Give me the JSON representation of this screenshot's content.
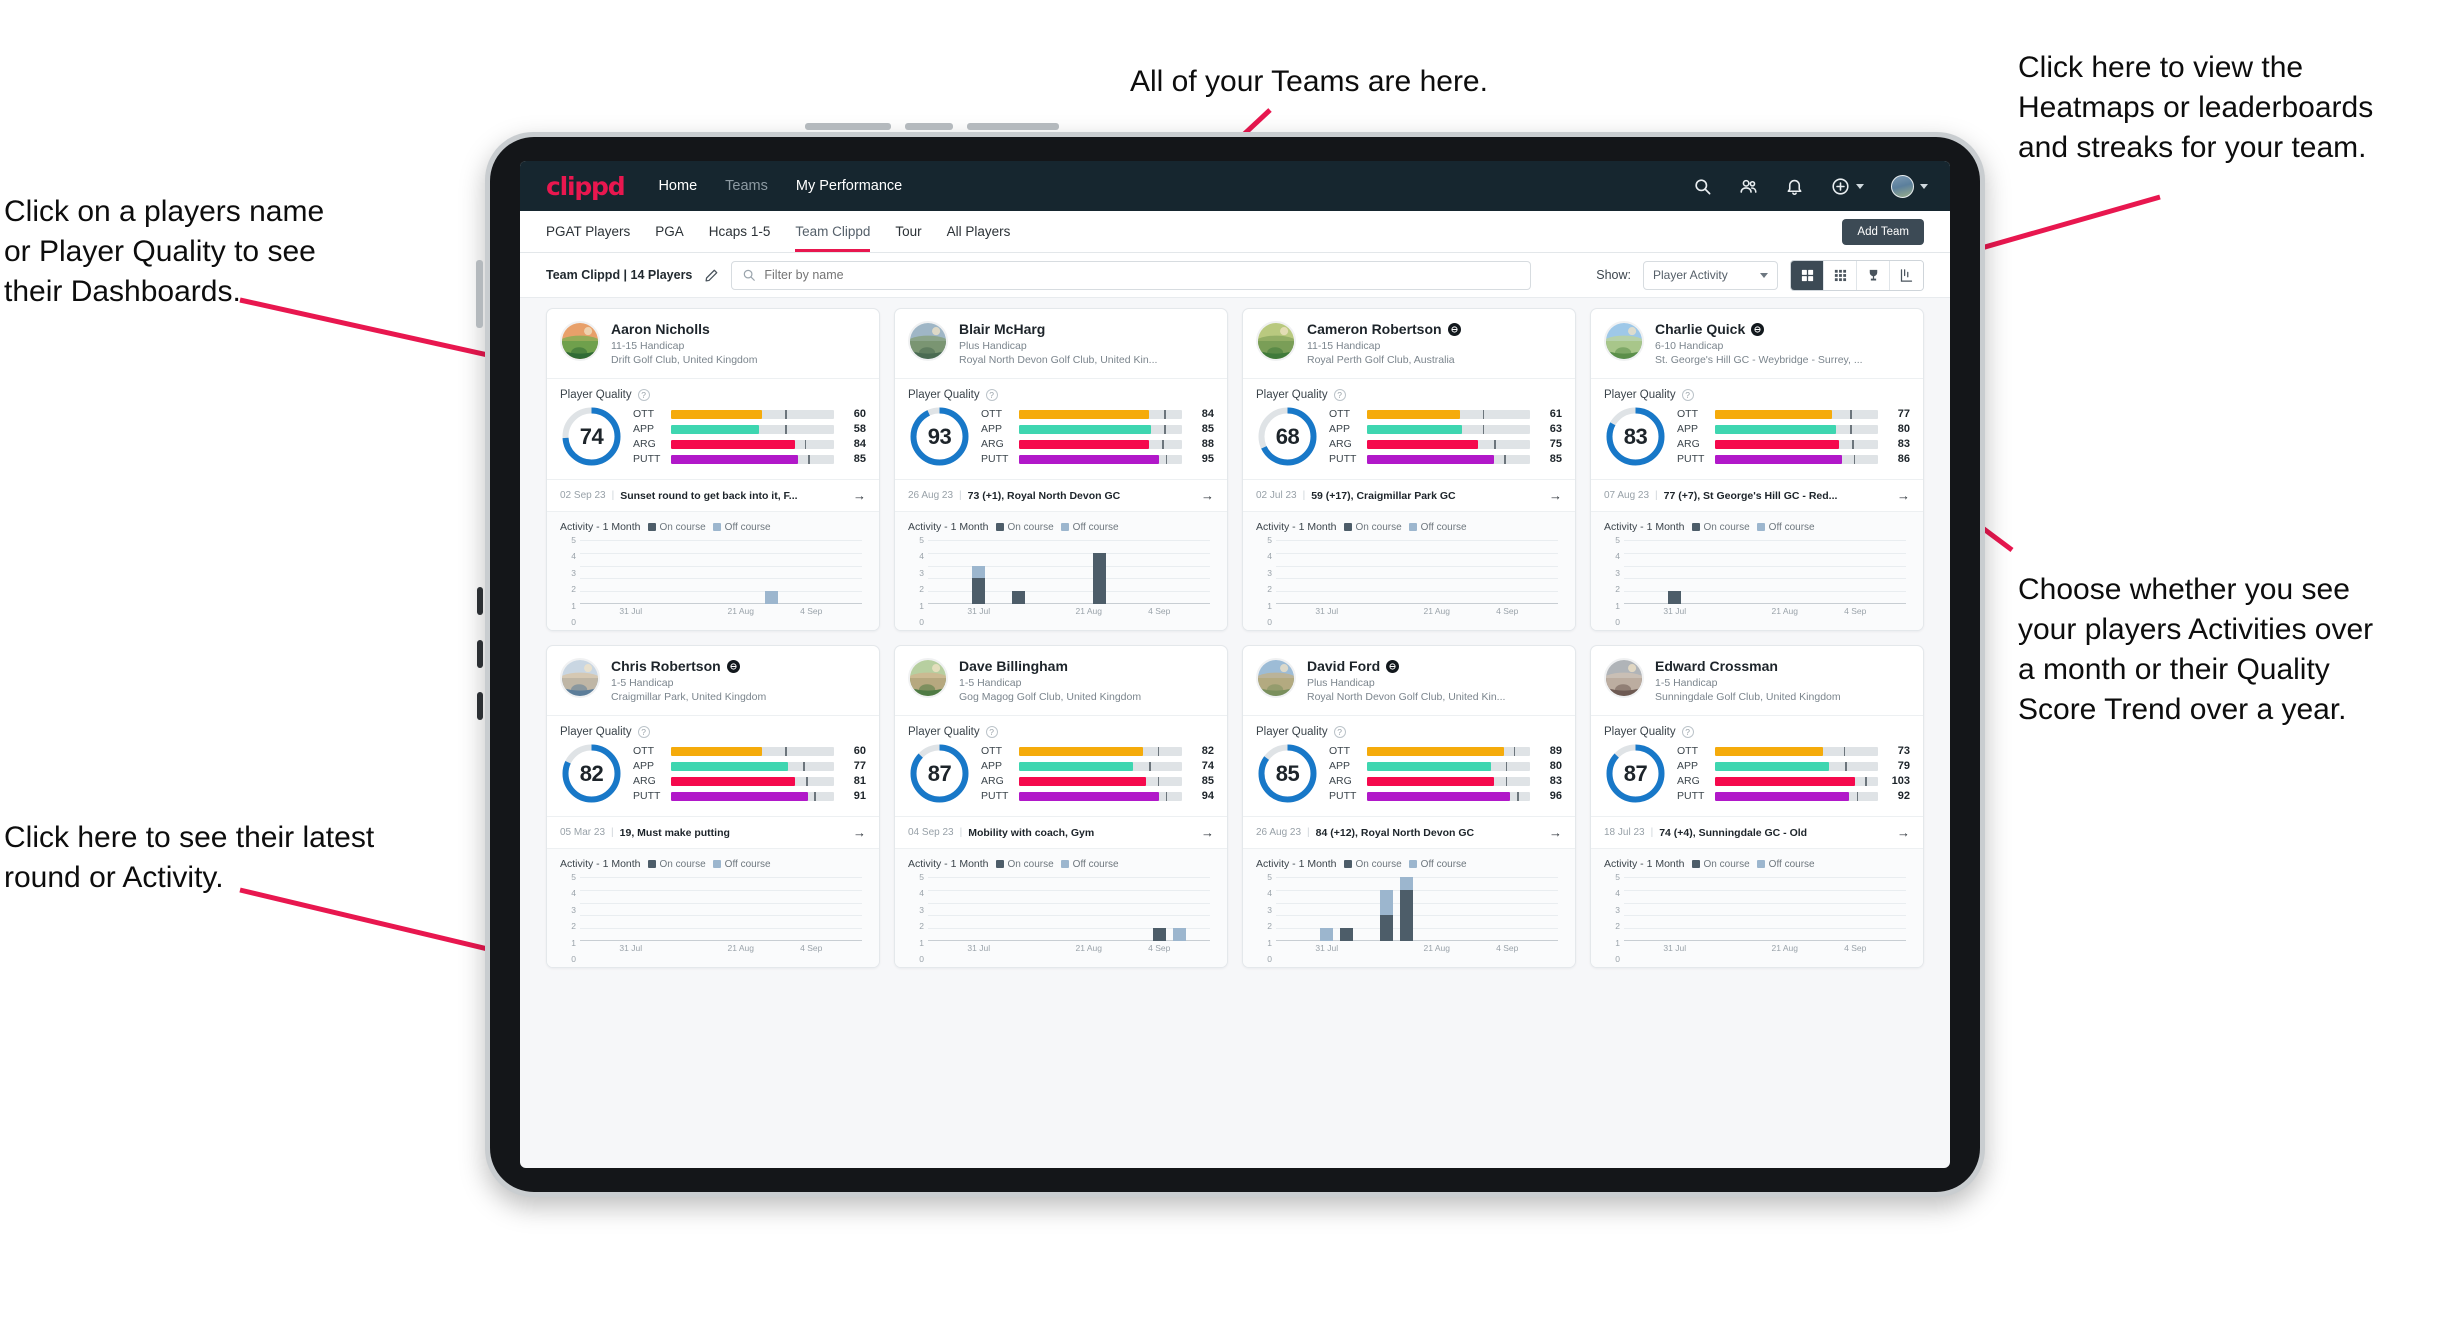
{
  "annotations": [
    {
      "id": "teams",
      "text": "All of your Teams are here."
    },
    {
      "id": "heatmaps",
      "text": "Click here to view the\nHeatmaps or leaderboards\nand streaks for your team."
    },
    {
      "id": "players-name",
      "text": "Click on a players name\nor Player Quality to see\ntheir Dashboards."
    },
    {
      "id": "show-toggle",
      "text": "Choose whether you see\nyour players Activities over\na month or their Quality\nScore Trend over a year."
    },
    {
      "id": "latest-round",
      "text": "Click here to see their latest\nround or Activity."
    }
  ],
  "navbar": {
    "brand": "clippd",
    "links": [
      {
        "label": "Home",
        "active": true
      },
      {
        "label": "Teams",
        "active": false
      },
      {
        "label": "My Performance",
        "active": true
      }
    ],
    "icons": [
      "search-icon",
      "people-icon",
      "bell-icon",
      "plus-circle-icon",
      "avatar"
    ]
  },
  "tabbar": {
    "tabs": [
      {
        "label": "PGAT Players",
        "active": false
      },
      {
        "label": "PGA",
        "active": false
      },
      {
        "label": "Hcaps 1-5",
        "active": false
      },
      {
        "label": "Team Clippd",
        "active": true
      },
      {
        "label": "Tour",
        "active": false
      },
      {
        "label": "All Players",
        "active": false
      }
    ],
    "add_team_label": "Add Team"
  },
  "filterbar": {
    "team_label": "Team Clippd | 14 Players",
    "edit_icon": "pencil-icon",
    "search_placeholder": "Filter by name",
    "search_value": "",
    "show_label": "Show:",
    "show_value": "Player Activity",
    "show_options": [
      "Player Activity",
      "Quality Score Trend"
    ],
    "view_buttons": [
      {
        "name": "grid-large-view",
        "active": true
      },
      {
        "name": "grid-small-view",
        "active": false
      },
      {
        "name": "leaderboard-trophy-view",
        "active": false
      },
      {
        "name": "heatmap-view",
        "active": false
      }
    ]
  },
  "card_labels": {
    "player_quality": "Player Quality",
    "activity": "Activity - 1 Month",
    "legend_on": "On course",
    "legend_off": "Off course",
    "metric_names": [
      "OTT",
      "APP",
      "ARG",
      "PUTT"
    ],
    "x_ticks": [
      "31 Jul",
      "21 Aug",
      "4 Sep"
    ],
    "y_ticks": [
      "5",
      "4",
      "3",
      "2",
      "1",
      "0"
    ],
    "arrow": "→",
    "help": "?"
  },
  "colors": {
    "brand": "#e8174f",
    "navbar": "#16262f",
    "ring": "#1878c8",
    "ott": "#f5ab0b",
    "app": "#3ed6b0",
    "arg": "#f5094d",
    "putt": "#b118c9",
    "on_course": "#4d5d69",
    "off_course": "#9cb6ce"
  },
  "players": [
    {
      "name": "Aaron Nicholls",
      "verified": false,
      "handicap": "11-15 Handicap",
      "club": "Drift Golf Club, United Kingdom",
      "quality": 74,
      "metrics": [
        {
          "label": "OTT",
          "value": 60,
          "fill": 56,
          "tick": 70
        },
        {
          "label": "APP",
          "value": 58,
          "fill": 54,
          "tick": 70
        },
        {
          "label": "ARG",
          "value": 84,
          "fill": 76,
          "tick": 82
        },
        {
          "label": "PUTT",
          "value": 85,
          "fill": 78,
          "tick": 84
        }
      ],
      "round": {
        "date": "02 Sep 23",
        "text": "Sunset round to get back into it, F..."
      },
      "chart_data": {
        "type": "bar",
        "stacked": true,
        "categories": [
          "c1",
          "c2",
          "c3",
          "c4",
          "c5",
          "c6",
          "c7",
          "c8",
          "c9",
          "c10",
          "c11",
          "c12",
          "c13",
          "c14"
        ],
        "series": [
          {
            "name": "On course",
            "values": [
              0,
              0,
              0,
              0,
              0,
              0,
              0,
              0,
              0,
              0,
              0,
              0,
              0,
              0
            ]
          },
          {
            "name": "Off course",
            "values": [
              0,
              0,
              0,
              0,
              0,
              0,
              0,
              0,
              0,
              1,
              0,
              0,
              0,
              0
            ]
          }
        ],
        "ylim": [
          0,
          5
        ]
      }
    },
    {
      "name": "Blair McHarg",
      "verified": false,
      "handicap": "Plus Handicap",
      "club": "Royal North Devon Golf Club, United Kin...",
      "quality": 93,
      "metrics": [
        {
          "label": "OTT",
          "value": 84,
          "fill": 80,
          "tick": 89
        },
        {
          "label": "APP",
          "value": 85,
          "fill": 81,
          "tick": 89
        },
        {
          "label": "ARG",
          "value": 88,
          "fill": 80,
          "tick": 88
        },
        {
          "label": "PUTT",
          "value": 95,
          "fill": 86,
          "tick": 90
        }
      ],
      "round": {
        "date": "26 Aug 23",
        "text": "73 (+1), Royal North Devon GC"
      },
      "chart_data": {
        "type": "bar",
        "stacked": true,
        "categories": [
          "c1",
          "c2",
          "c3",
          "c4",
          "c5",
          "c6",
          "c7",
          "c8",
          "c9",
          "c10",
          "c11",
          "c12",
          "c13",
          "c14"
        ],
        "series": [
          {
            "name": "On course",
            "values": [
              0,
              0,
              2,
              0,
              1,
              0,
              0,
              0,
              4,
              0,
              0,
              0,
              0,
              0
            ]
          },
          {
            "name": "Off course",
            "values": [
              0,
              0,
              1,
              0,
              0,
              0,
              0,
              0,
              0,
              0,
              0,
              0,
              0,
              0
            ]
          }
        ],
        "ylim": [
          0,
          5
        ]
      }
    },
    {
      "name": "Cameron Robertson",
      "verified": true,
      "handicap": "11-15 Handicap",
      "club": "Royal Perth Golf Club, Australia",
      "quality": 68,
      "metrics": [
        {
          "label": "OTT",
          "value": 61,
          "fill": 57,
          "tick": 71
        },
        {
          "label": "APP",
          "value": 63,
          "fill": 58,
          "tick": 71
        },
        {
          "label": "ARG",
          "value": 75,
          "fill": 68,
          "tick": 78
        },
        {
          "label": "PUTT",
          "value": 85,
          "fill": 78,
          "tick": 84
        }
      ],
      "round": {
        "date": "02 Jul 23",
        "text": "59 (+17), Craigmillar Park GC"
      },
      "chart_data": {
        "type": "bar",
        "stacked": true,
        "categories": [
          "c1",
          "c2",
          "c3",
          "c4",
          "c5",
          "c6",
          "c7",
          "c8",
          "c9",
          "c10",
          "c11",
          "c12",
          "c13",
          "c14"
        ],
        "series": [
          {
            "name": "On course",
            "values": [
              0,
              0,
              0,
              0,
              0,
              0,
              0,
              0,
              0,
              0,
              0,
              0,
              0,
              0
            ]
          },
          {
            "name": "Off course",
            "values": [
              0,
              0,
              0,
              0,
              0,
              0,
              0,
              0,
              0,
              0,
              0,
              0,
              0,
              0
            ]
          }
        ],
        "ylim": [
          0,
          5
        ]
      }
    },
    {
      "name": "Charlie Quick",
      "verified": true,
      "handicap": "6-10 Handicap",
      "club": "St. George's Hill GC - Weybridge - Surrey, ...",
      "quality": 83,
      "metrics": [
        {
          "label": "OTT",
          "value": 77,
          "fill": 72,
          "tick": 83
        },
        {
          "label": "APP",
          "value": 80,
          "fill": 74,
          "tick": 83
        },
        {
          "label": "ARG",
          "value": 83,
          "fill": 76,
          "tick": 84
        },
        {
          "label": "PUTT",
          "value": 86,
          "fill": 78,
          "tick": 85
        }
      ],
      "round": {
        "date": "07 Aug 23",
        "text": "77 (+7), St George's Hill GC - Red..."
      },
      "chart_data": {
        "type": "bar",
        "stacked": true,
        "categories": [
          "c1",
          "c2",
          "c3",
          "c4",
          "c5",
          "c6",
          "c7",
          "c8",
          "c9",
          "c10",
          "c11",
          "c12",
          "c13",
          "c14"
        ],
        "series": [
          {
            "name": "On course",
            "values": [
              0,
              0,
              1,
              0,
              0,
              0,
              0,
              0,
              0,
              0,
              0,
              0,
              0,
              0
            ]
          },
          {
            "name": "Off course",
            "values": [
              0,
              0,
              0,
              0,
              0,
              0,
              0,
              0,
              0,
              0,
              0,
              0,
              0,
              0
            ]
          }
        ],
        "ylim": [
          0,
          5
        ]
      }
    },
    {
      "name": "Chris Robertson",
      "verified": true,
      "handicap": "1-5 Handicap",
      "club": "Craigmillar Park, United Kingdom",
      "quality": 82,
      "metrics": [
        {
          "label": "OTT",
          "value": 60,
          "fill": 56,
          "tick": 70
        },
        {
          "label": "APP",
          "value": 77,
          "fill": 72,
          "tick": 81
        },
        {
          "label": "ARG",
          "value": 81,
          "fill": 76,
          "tick": 83
        },
        {
          "label": "PUTT",
          "value": 91,
          "fill": 84,
          "tick": 88
        }
      ],
      "round": {
        "date": "05 Mar 23",
        "text": "19, Must make putting"
      },
      "chart_data": {
        "type": "bar",
        "stacked": true,
        "categories": [
          "c1",
          "c2",
          "c3",
          "c4",
          "c5",
          "c6",
          "c7",
          "c8",
          "c9",
          "c10",
          "c11",
          "c12",
          "c13",
          "c14"
        ],
        "series": [
          {
            "name": "On course",
            "values": [
              0,
              0,
              0,
              0,
              0,
              0,
              0,
              0,
              0,
              0,
              0,
              0,
              0,
              0
            ]
          },
          {
            "name": "Off course",
            "values": [
              0,
              0,
              0,
              0,
              0,
              0,
              0,
              0,
              0,
              0,
              0,
              0,
              0,
              0
            ]
          }
        ],
        "ylim": [
          0,
          5
        ]
      }
    },
    {
      "name": "Dave Billingham",
      "verified": false,
      "handicap": "1-5 Handicap",
      "club": "Gog Magog Golf Club, United Kingdom",
      "quality": 87,
      "metrics": [
        {
          "label": "OTT",
          "value": 82,
          "fill": 76,
          "tick": 85
        },
        {
          "label": "APP",
          "value": 74,
          "fill": 70,
          "tick": 80
        },
        {
          "label": "ARG",
          "value": 85,
          "fill": 78,
          "tick": 85
        },
        {
          "label": "PUTT",
          "value": 94,
          "fill": 86,
          "tick": 90
        }
      ],
      "round": {
        "date": "04 Sep 23",
        "text": "Mobility with coach, Gym"
      },
      "chart_data": {
        "type": "bar",
        "stacked": true,
        "categories": [
          "c1",
          "c2",
          "c3",
          "c4",
          "c5",
          "c6",
          "c7",
          "c8",
          "c9",
          "c10",
          "c11",
          "c12",
          "c13",
          "c14"
        ],
        "series": [
          {
            "name": "On course",
            "values": [
              0,
              0,
              0,
              0,
              0,
              0,
              0,
              0,
              0,
              0,
              0,
              1,
              0,
              0
            ]
          },
          {
            "name": "Off course",
            "values": [
              0,
              0,
              0,
              0,
              0,
              0,
              0,
              0,
              0,
              0,
              0,
              0,
              1,
              0
            ]
          }
        ],
        "ylim": [
          0,
          5
        ]
      }
    },
    {
      "name": "David Ford",
      "verified": true,
      "handicap": "Plus Handicap",
      "club": "Royal North Devon Golf Club, United Kin...",
      "quality": 85,
      "metrics": [
        {
          "label": "OTT",
          "value": 89,
          "fill": 84,
          "tick": 90
        },
        {
          "label": "APP",
          "value": 80,
          "fill": 76,
          "tick": 85
        },
        {
          "label": "ARG",
          "value": 83,
          "fill": 78,
          "tick": 85
        },
        {
          "label": "PUTT",
          "value": 96,
          "fill": 88,
          "tick": 92
        }
      ],
      "round": {
        "date": "26 Aug 23",
        "text": "84 (+12), Royal North Devon GC"
      },
      "chart_data": {
        "type": "bar",
        "stacked": true,
        "categories": [
          "c1",
          "c2",
          "c3",
          "c4",
          "c5",
          "c6",
          "c7",
          "c8",
          "c9",
          "c10",
          "c11",
          "c12",
          "c13",
          "c14"
        ],
        "series": [
          {
            "name": "On course",
            "values": [
              0,
              0,
              0,
              1,
              0,
              2,
              4,
              0,
              0,
              0,
              0,
              0,
              0,
              0
            ]
          },
          {
            "name": "Off course",
            "values": [
              0,
              0,
              1,
              0,
              0,
              2,
              1,
              0,
              0,
              0,
              0,
              0,
              0,
              0
            ]
          }
        ],
        "ylim": [
          0,
          5
        ]
      }
    },
    {
      "name": "Edward Crossman",
      "verified": false,
      "handicap": "1-5 Handicap",
      "club": "Sunningdale Golf Club, United Kingdom",
      "quality": 87,
      "metrics": [
        {
          "label": "OTT",
          "value": 73,
          "fill": 66,
          "tick": 79
        },
        {
          "label": "APP",
          "value": 79,
          "fill": 70,
          "tick": 80
        },
        {
          "label": "ARG",
          "value": 103,
          "fill": 86,
          "tick": 92
        },
        {
          "label": "PUTT",
          "value": 92,
          "fill": 82,
          "tick": 87
        }
      ],
      "round": {
        "date": "18 Jul 23",
        "text": "74 (+4), Sunningdale GC - Old"
      },
      "chart_data": {
        "type": "bar",
        "stacked": true,
        "categories": [
          "c1",
          "c2",
          "c3",
          "c4",
          "c5",
          "c6",
          "c7",
          "c8",
          "c9",
          "c10",
          "c11",
          "c12",
          "c13",
          "c14"
        ],
        "series": [
          {
            "name": "On course",
            "values": [
              0,
              0,
              0,
              0,
              0,
              0,
              0,
              0,
              0,
              0,
              0,
              0,
              0,
              0
            ]
          },
          {
            "name": "Off course",
            "values": [
              0,
              0,
              0,
              0,
              0,
              0,
              0,
              0,
              0,
              0,
              0,
              0,
              0,
              0
            ]
          }
        ],
        "ylim": [
          0,
          5
        ]
      }
    }
  ]
}
